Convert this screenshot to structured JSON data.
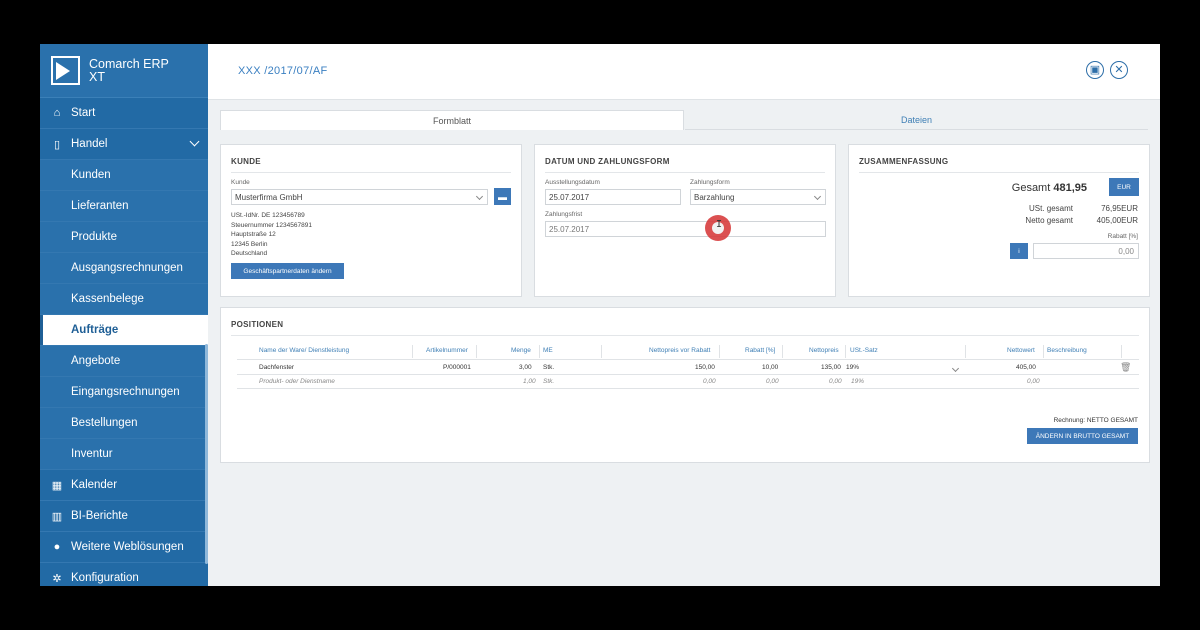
{
  "app": {
    "name_line1": "Comarch ERP",
    "name_line2": "XT"
  },
  "sidebar": {
    "items": [
      {
        "label": "Start",
        "icon": "home-icon"
      },
      {
        "label": "Handel",
        "icon": "clipboard-icon"
      },
      {
        "label": "Kunden"
      },
      {
        "label": "Lieferanten"
      },
      {
        "label": "Produkte"
      },
      {
        "label": "Ausgangsrechnungen"
      },
      {
        "label": "Kassenbelege"
      },
      {
        "label": "Aufträge"
      },
      {
        "label": "Angebote"
      },
      {
        "label": "Eingangsrechnungen"
      },
      {
        "label": "Bestellungen"
      },
      {
        "label": "Inventur"
      },
      {
        "label": "Kalender",
        "icon": "calendar-icon"
      },
      {
        "label": "BI-Berichte",
        "icon": "bar-chart-icon"
      },
      {
        "label": "Weitere Weblösungen",
        "icon": "globe-icon"
      },
      {
        "label": "Konfiguration",
        "icon": "gear-icon"
      }
    ]
  },
  "header": {
    "title": "XXX  /2017/07/AF"
  },
  "tabs": [
    {
      "label": "Formblatt"
    },
    {
      "label": "Dateien"
    }
  ],
  "kunde": {
    "title": "KUNDE",
    "field_label": "Kunde",
    "value": "Musterfirma GmbH",
    "details": [
      "USt.-IdNr. DE 123456789",
      "Steuernummer 1234567891",
      "Hauptstraße 12",
      "12345 Berlin",
      "Deutschland"
    ],
    "change_button": "Geschäftspartnerdaten ändern"
  },
  "datum": {
    "title": "DATUM UND ZAHLUNGSFORM",
    "ausstellungsdatum_label": "Ausstellungsdatum",
    "ausstellungsdatum": "25.07.2017",
    "zahlungsform_label": "Zahlungsform",
    "zahlungsform": "Barzahlung",
    "zahlungsfrist_label": "Zahlungsfrist",
    "zahlungsfrist": "25.07.2017"
  },
  "summary": {
    "title": "ZUSAMMENFASSUNG",
    "gesamt_label": "Gesamt",
    "gesamt_value": "481,95",
    "currency": "EUR",
    "ust_label": "USt. gesamt",
    "ust_value": "76,95EUR",
    "netto_label": "Netto gesamt",
    "netto_value": "405,00EUR",
    "rabatt_label": "Rabatt [%]",
    "rabatt_value": "0,00",
    "rabatt_btn": "i"
  },
  "positionen": {
    "title": "POSITIONEN",
    "headers": {
      "name": "Name der Ware/ Dienstleistung",
      "artikel": "Artikelnummer",
      "menge": "Menge",
      "me": "ME",
      "nettovor": "Nettopreis vor Rabatt",
      "rabatt": "Rabatt [%]",
      "nettopreis": "Nettopreis",
      "ust": "USt.-Satz",
      "nettowert": "Nettowert",
      "beschreibung": "Beschreibung"
    },
    "row": {
      "name": "Dachfenster",
      "artikel": "P/000001",
      "menge": "3,00",
      "me": "Stk.",
      "nettovor": "150,00",
      "rabatt": "10,00",
      "nettopreis": "135,00",
      "ust": "19%",
      "nettowert": "405,00"
    },
    "new_row": {
      "name": "Produkt- oder Dienstname",
      "menge": "1,00",
      "me": "Stk.",
      "nettovor": "0,00",
      "rabatt": "0,00",
      "nettopreis": "0,00",
      "ust": "19%",
      "nettowert": "0,00"
    },
    "rechnung_label": "Rechnung: NETTO GESAMT",
    "brutto_button": "ÄNDERN IN BRUTTO GESAMT"
  },
  "colors": {
    "sidebar": "#2a71ac",
    "accent": "#3d78b8",
    "cursor": "#d7393a"
  }
}
